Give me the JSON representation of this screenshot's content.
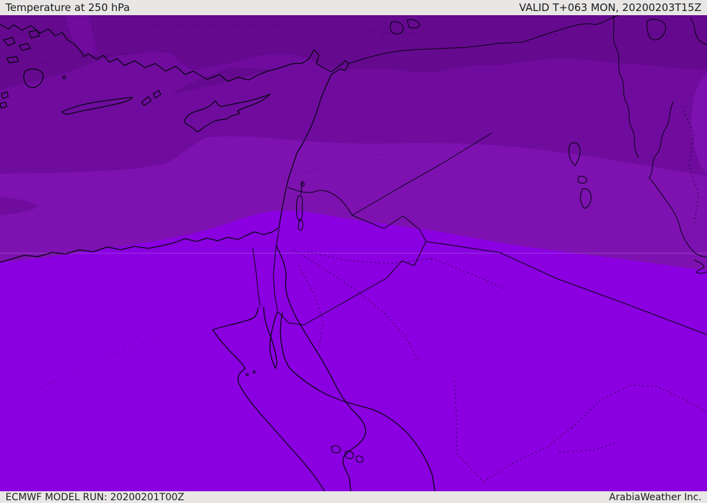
{
  "header": {
    "title": "Temperature at 250 hPa",
    "valid_label": "VALID T+063 MON, 20200203T15Z"
  },
  "footer": {
    "model_run_label": "ECMWF MODEL RUN: 20200201T00Z",
    "credit_label": "ArabiaWeather Inc."
  },
  "map": {
    "description": "ECMWF 250 hPa temperature shading over the eastern Mediterranean, Levant, Egypt and Arabia; darker purple is colder (north), brighter violet is warmer (south)",
    "colors": {
      "bar_bg": "#E9E7E6",
      "bar_text": "#1B1B1B",
      "shade_coldest": "#65098F",
      "shade_cold": "#6F0C9E",
      "shade_mild": "#7D12B0",
      "shade_warm": "#8A00E0",
      "outline": "#05050F",
      "graticule": "#C9A0F0"
    }
  }
}
